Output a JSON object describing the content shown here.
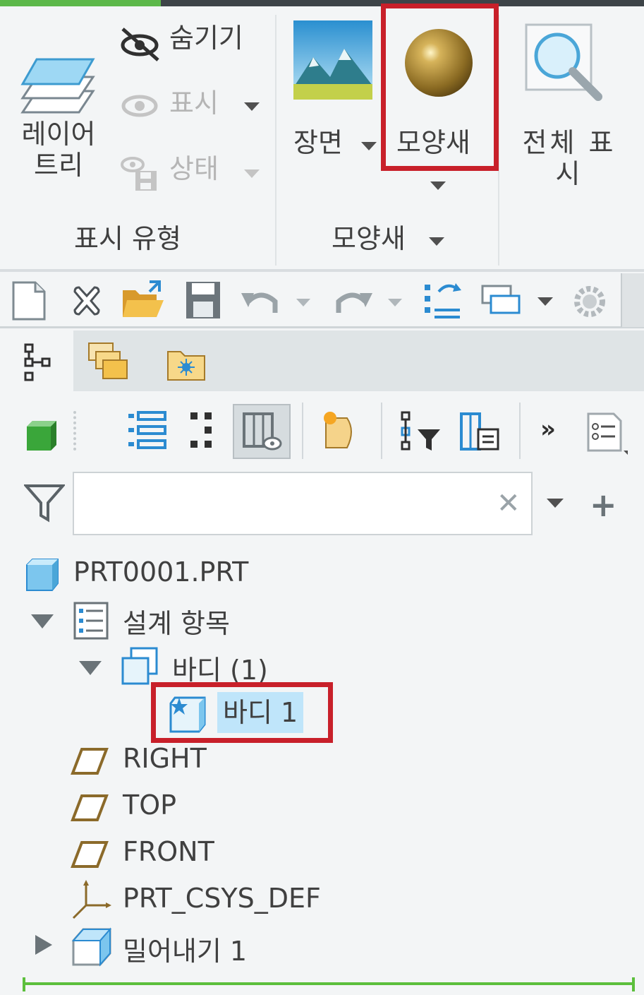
{
  "ribbon": {
    "layer_tree_label": "레이어\n트리",
    "hide_label": "숨기기",
    "show_label": "표시",
    "status_label": "상태",
    "display_group_label": "표시 유형",
    "scene_label": "장면",
    "appearance_label": "모양새",
    "appearance_group_label": "모양새",
    "zoom_all_label": "전체 표\n시"
  },
  "model_tree": {
    "search_value": "",
    "items": [
      {
        "label": "PRT0001.PRT",
        "icon": "part-icon"
      },
      {
        "label": "설계 항목",
        "icon": "design-items-icon",
        "expanded": true
      },
      {
        "label": "바디 (1)",
        "icon": "bodies-icon",
        "expanded": true
      },
      {
        "label": "바디 1",
        "icon": "body-icon",
        "selected": true
      },
      {
        "label": "RIGHT",
        "icon": "datum-plane-icon"
      },
      {
        "label": "TOP",
        "icon": "datum-plane-icon"
      },
      {
        "label": "FRONT",
        "icon": "datum-plane-icon"
      },
      {
        "label": "PRT_CSYS_DEF",
        "icon": "csys-icon"
      },
      {
        "label": "밀어내기 1",
        "icon": "extrude-icon",
        "expanded": false
      }
    ]
  },
  "colors": {
    "highlight": "#c8202a",
    "selection": "#bfe5fa",
    "accent_green": "#5cb84a"
  }
}
